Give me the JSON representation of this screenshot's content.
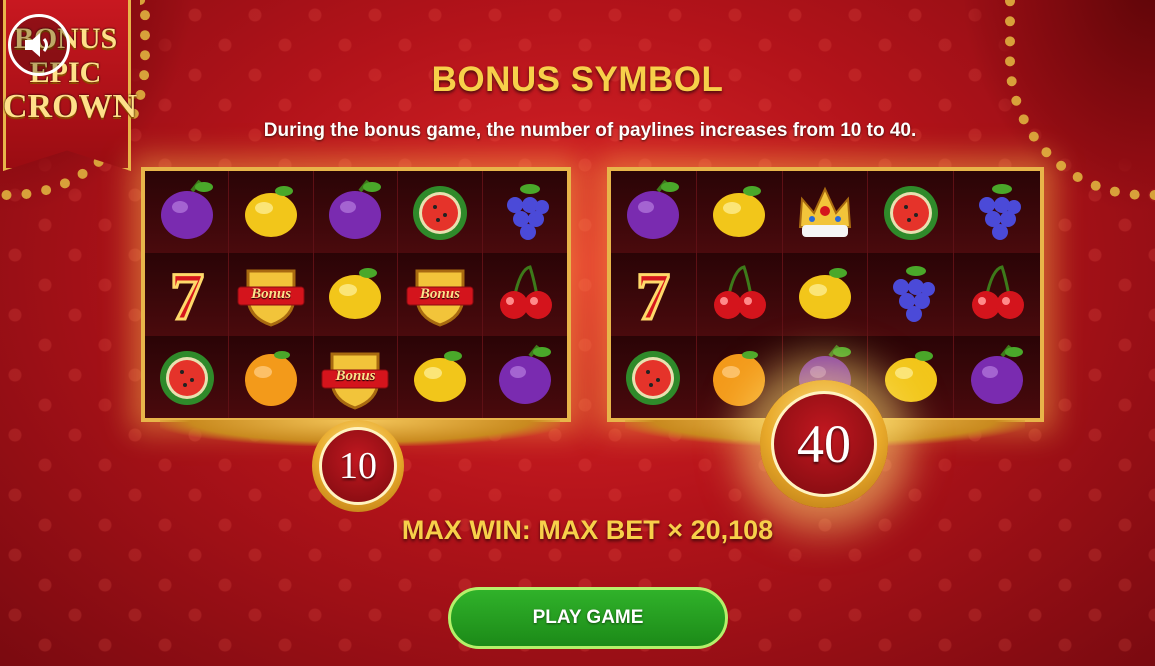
{
  "logo": {
    "line1": "BONUS",
    "line2": "EPIC",
    "line3": "CROWN"
  },
  "sound": {
    "icon": "speaker-icon"
  },
  "title": "BONUS SYMBOL",
  "subtitle": "During the bonus game, the number of paylines increases from 10 to 40.",
  "left_panel": {
    "symbols": [
      "plum",
      "lemon",
      "plum",
      "watermelon",
      "grapes",
      "seven",
      "bonus",
      "lemon",
      "bonus",
      "cherry",
      "watermelon",
      "orange",
      "bonus",
      "lemon",
      "plum"
    ],
    "bonus_label": "Bonus",
    "paylines": "10"
  },
  "right_panel": {
    "symbols": [
      "plum",
      "lemon",
      "crown",
      "watermelon",
      "grapes",
      "seven",
      "cherry",
      "lemon",
      "grapes",
      "cherry",
      "watermelon",
      "orange",
      "plum",
      "lemon",
      "plum"
    ],
    "paylines": "40"
  },
  "max_win": "MAX WIN: MAX BET × 20,108",
  "play_button": "PLAY GAME",
  "colors": {
    "gold": "#f7d04a",
    "button_green": "#1c8a18",
    "background_red": "#b3131a"
  }
}
